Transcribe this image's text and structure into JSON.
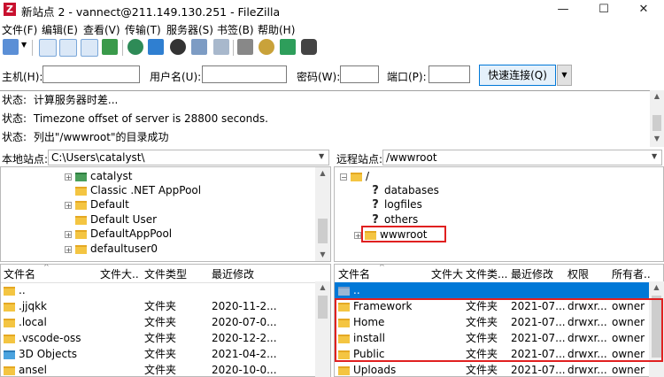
{
  "window": {
    "title": "新站点 2 - vannect@211.149.130.251 - FileZilla",
    "app_icon": "Z",
    "minimize": "—",
    "maximize": "☐",
    "close": "✕"
  },
  "menu": [
    "文件(F)",
    "编辑(E)",
    "查看(V)",
    "传输(T)",
    "服务器(S)",
    "书签(B)",
    "帮助(H)"
  ],
  "toolbar_icons": [
    "site-manager-icon",
    "toggle-log-icon",
    "toggle-local-tree-icon",
    "toggle-remote-tree-icon",
    "toggle-queue-icon",
    "refresh-icon",
    "process-queue-icon",
    "cancel-icon",
    "disconnect-icon",
    "reconnect-icon",
    "filter-icon",
    "compare-icon",
    "sync-browse-icon",
    "search-icon"
  ],
  "quickconnect": {
    "host_label": "主机(H):",
    "user_label": "用户名(U):",
    "pass_label": "密码(W):",
    "port_label": "端口(P):",
    "host_value": "",
    "user_value": "",
    "pass_value": "",
    "port_value": "",
    "button": "快速连接(Q)",
    "dropdown": "▼"
  },
  "log": [
    {
      "label": "状态:",
      "text": "计算服务器时差..."
    },
    {
      "label": "状态:",
      "text": "Timezone offset of server is 28800 seconds."
    },
    {
      "label": "状态:",
      "text": "列出\"/wwwroot\"的目录成功"
    }
  ],
  "local": {
    "site_label": "本地站点:",
    "path": "C:\\Users\\catalyst\\",
    "tree": [
      {
        "name": "catalyst",
        "expander": "+",
        "icon": "user-folder"
      },
      {
        "name": "Classic .NET AppPool",
        "expander": "",
        "icon": "folder"
      },
      {
        "name": "Default",
        "expander": "+",
        "icon": "folder"
      },
      {
        "name": "Default User",
        "expander": "",
        "icon": "folder"
      },
      {
        "name": "DefaultAppPool",
        "expander": "+",
        "icon": "folder"
      },
      {
        "name": "defaultuser0",
        "expander": "+",
        "icon": "folder"
      }
    ],
    "columns": [
      "文件名",
      "文件大...",
      "文件类型",
      "最近修改"
    ],
    "files": [
      {
        "name": "..",
        "size": "",
        "type": "",
        "modified": "",
        "icon": "folder"
      },
      {
        "name": ".jjqkk",
        "size": "",
        "type": "文件夹",
        "modified": "2020-11-2...",
        "icon": "folder"
      },
      {
        "name": ".local",
        "size": "",
        "type": "文件夹",
        "modified": "2020-07-0...",
        "icon": "folder"
      },
      {
        "name": ".vscode-oss",
        "size": "",
        "type": "文件夹",
        "modified": "2020-12-2...",
        "icon": "folder"
      },
      {
        "name": "3D Objects",
        "size": "",
        "type": "文件夹",
        "modified": "2021-04-2...",
        "icon": "3d-objects"
      },
      {
        "name": "ansel",
        "size": "",
        "type": "文件夹",
        "modified": "2020-10-0...",
        "icon": "folder"
      }
    ]
  },
  "remote": {
    "site_label": "远程站点:",
    "path": "/wwwroot",
    "tree": [
      {
        "name": "/",
        "expander": "−",
        "icon": "folder",
        "level": 0
      },
      {
        "name": "databases",
        "expander": "",
        "icon": "unknown",
        "level": 1
      },
      {
        "name": "logfiles",
        "expander": "",
        "icon": "unknown",
        "level": 1
      },
      {
        "name": "others",
        "expander": "",
        "icon": "unknown",
        "level": 1
      },
      {
        "name": "wwwroot",
        "expander": "+",
        "icon": "folder",
        "level": 1,
        "highlight": true
      }
    ],
    "columns": [
      "文件名",
      "文件大...",
      "文件类...",
      "最近修改",
      "权限",
      "所有者..."
    ],
    "files": [
      {
        "name": "..",
        "size": "",
        "type": "",
        "modified": "",
        "perms": "",
        "owner": "",
        "selected": true
      },
      {
        "name": "Framework",
        "size": "",
        "type": "文件夹",
        "modified": "2021-07...",
        "perms": "drwxr...",
        "owner": "owner ..."
      },
      {
        "name": "Home",
        "size": "",
        "type": "文件夹",
        "modified": "2021-07...",
        "perms": "drwxr...",
        "owner": "owner ..."
      },
      {
        "name": "install",
        "size": "",
        "type": "文件夹",
        "modified": "2021-07...",
        "perms": "drwxr...",
        "owner": "owner ..."
      },
      {
        "name": "Public",
        "size": "",
        "type": "文件夹",
        "modified": "2021-07...",
        "perms": "drwxr...",
        "owner": "owner ..."
      },
      {
        "name": "Uploads",
        "size": "",
        "type": "文件夹",
        "modified": "2021-07...",
        "perms": "drwxr...",
        "owner": "owner ..."
      }
    ]
  },
  "colors": {
    "selection": "#0078d7",
    "highlight_border": "#e02020",
    "folder": "#f4c542"
  }
}
